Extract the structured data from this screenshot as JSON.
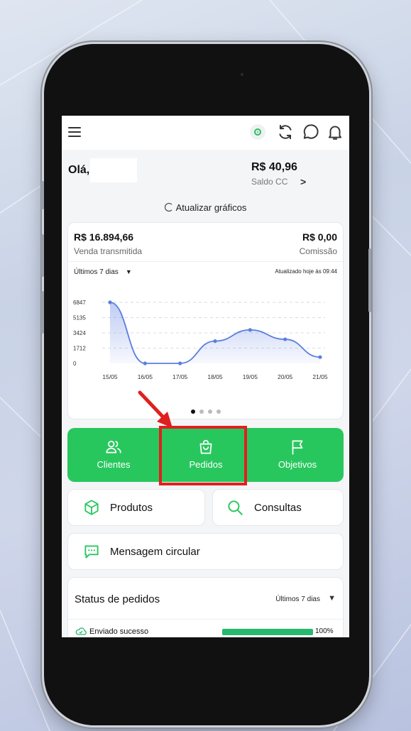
{
  "colors": {
    "accent": "#28c75e",
    "highlight": "#e01f1f",
    "chart_line": "#5b7fe0"
  },
  "greeting": "Olá,",
  "balance": {
    "value": "R$ 40,96",
    "label": "Saldo CC",
    "chevron": ">"
  },
  "refresh_label": "Atualizar gráficos",
  "sales_card": {
    "sales_value": "R$ 16.894,66",
    "sales_label": "Venda transmitida",
    "commission_value": "R$ 0,00",
    "commission_label": "Comissão",
    "period": "Últimos 7 dias",
    "updated": "Atualizado hoje às 09:44"
  },
  "chart_data": {
    "type": "area",
    "x": [
      "15/05",
      "16/05",
      "17/05",
      "18/05",
      "19/05",
      "20/05",
      "21/05"
    ],
    "values": [
      6847,
      0,
      0,
      2500,
      3750,
      2700,
      700
    ],
    "yticks": [
      "6847",
      "5135",
      "3424",
      "1712",
      "0"
    ],
    "ylim": [
      0,
      6847
    ],
    "grid": true
  },
  "carousel": {
    "pages": 4,
    "active": 1
  },
  "quick_actions": [
    {
      "label": "Clientes",
      "icon": "users-icon"
    },
    {
      "label": "Pedidos",
      "icon": "shopping-bag-icon"
    },
    {
      "label": "Objetivos",
      "icon": "flag-icon"
    }
  ],
  "tiles": {
    "produtos": "Produtos",
    "consultas": "Consultas",
    "mensagem": "Mensagem circular"
  },
  "order_status": {
    "title": "Status de pedidos",
    "period": "Últimos 7 dias",
    "rows": [
      {
        "label": "Enviado sucesso",
        "value": "100%",
        "fraction": 1.0
      }
    ]
  },
  "icons": [
    "menu-icon",
    "location-icon",
    "sync-icon",
    "chat-icon",
    "bell-icon"
  ]
}
